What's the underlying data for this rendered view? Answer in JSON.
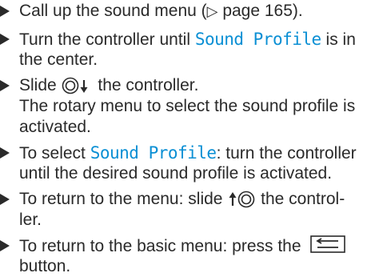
{
  "steps": [
    {
      "lines": [
        {
          "pre": "Call up the sound menu (",
          "glyph": "▷",
          "post": " page 165)."
        }
      ]
    },
    {
      "lines": [
        {
          "pre": "Turn the controller until ",
          "hl": "Sound Profile",
          "post": " is in"
        },
        {
          "text": "the center."
        }
      ]
    },
    {
      "lines": [
        {
          "pre": "Slide ",
          "post": " the controller."
        },
        {
          "text": "The rotary menu to select the sound profile is"
        },
        {
          "text": "activated."
        }
      ]
    },
    {
      "lines": [
        {
          "pre": "To select ",
          "hl": "Sound Profile",
          "post": ": turn the controller"
        },
        {
          "text": "until the desired sound profile is activated."
        }
      ]
    },
    {
      "lines": [
        {
          "pre": "To return to the menu: slide ",
          "post": " the control-"
        },
        {
          "text": "ler."
        }
      ]
    },
    {
      "lines": [
        {
          "pre": "To return to the basic menu: press the "
        },
        {
          "text": "button."
        }
      ]
    }
  ],
  "icons": {
    "bullet": "triangle-bullet",
    "page_ref": "open-triangle-icon",
    "controller_down": "controller-slide-down-icon",
    "controller_up": "controller-slide-up-icon",
    "back": "back-button-icon"
  },
  "colors": {
    "highlight": "#0a8fd4",
    "text": "#2a2a2a"
  }
}
